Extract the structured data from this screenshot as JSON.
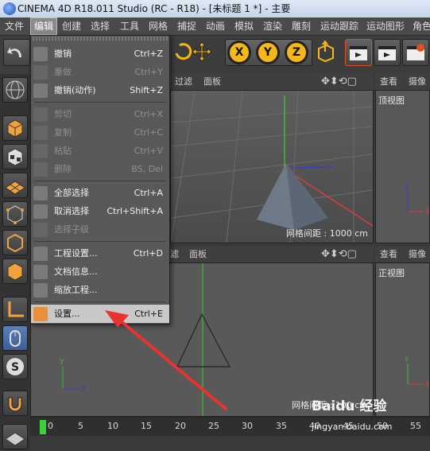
{
  "window": {
    "title": "CINEMA 4D R18.011 Studio (RC - R18) - [未标题 1 *] - 主要"
  },
  "menubar": [
    "文件",
    "编辑",
    "创建",
    "选择",
    "工具",
    "网格",
    "捕捉",
    "动画",
    "模拟",
    "渲染",
    "雕刻",
    "运动跟踪",
    "运动图形",
    "角色"
  ],
  "toolbar": {
    "axis_x": "X",
    "axis_y": "Y",
    "axis_z": "Z"
  },
  "viewport_top": {
    "menus": [
      "过滤",
      "面板"
    ],
    "grid": "网格间距 : 1000 cm"
  },
  "viewport_front": {
    "menus": [
      "滤",
      "面板"
    ],
    "grid": "网格间距 : 100 cm"
  },
  "side_top": {
    "menus": [
      "查看",
      "摄像机"
    ],
    "name": "顶视图"
  },
  "side_front": {
    "menus": [
      "查看",
      "摄像机"
    ],
    "name": "正视图"
  },
  "edit_menu": {
    "items": [
      {
        "label": "撤销",
        "shortcut": "Ctrl+Z",
        "enabled": true
      },
      {
        "label": "重做",
        "shortcut": "Ctrl+Y",
        "enabled": false
      },
      {
        "label": "撤销(动作)",
        "shortcut": "Shift+Z",
        "enabled": true
      },
      {
        "label": "剪切",
        "shortcut": "Ctrl+X",
        "enabled": false
      },
      {
        "label": "复制",
        "shortcut": "Ctrl+C",
        "enabled": false
      },
      {
        "label": "粘贴",
        "shortcut": "Ctrl+V",
        "enabled": false
      },
      {
        "label": "删除",
        "shortcut": "BS, Del",
        "enabled": false
      },
      {
        "label": "全部选择",
        "shortcut": "Ctrl+A",
        "enabled": true
      },
      {
        "label": "取消选择",
        "shortcut": "Ctrl+Shift+A",
        "enabled": true
      },
      {
        "label": "选择子级",
        "shortcut": "",
        "enabled": false
      },
      {
        "label": "工程设置...",
        "shortcut": "Ctrl+D",
        "enabled": true
      },
      {
        "label": "文档信息...",
        "shortcut": "",
        "enabled": true
      },
      {
        "label": "缩放工程...",
        "shortcut": "",
        "enabled": true
      },
      {
        "label": "设置...",
        "shortcut": "Ctrl+E",
        "enabled": true,
        "highlighted": true
      }
    ]
  },
  "timeline": {
    "ticks": [
      "0",
      "5",
      "10",
      "15",
      "20",
      "25",
      "30",
      "35",
      "40",
      "45",
      "50",
      "55"
    ]
  },
  "watermark": {
    "brand": "Baidu 经验",
    "url": "jingyan.baidu.com"
  }
}
